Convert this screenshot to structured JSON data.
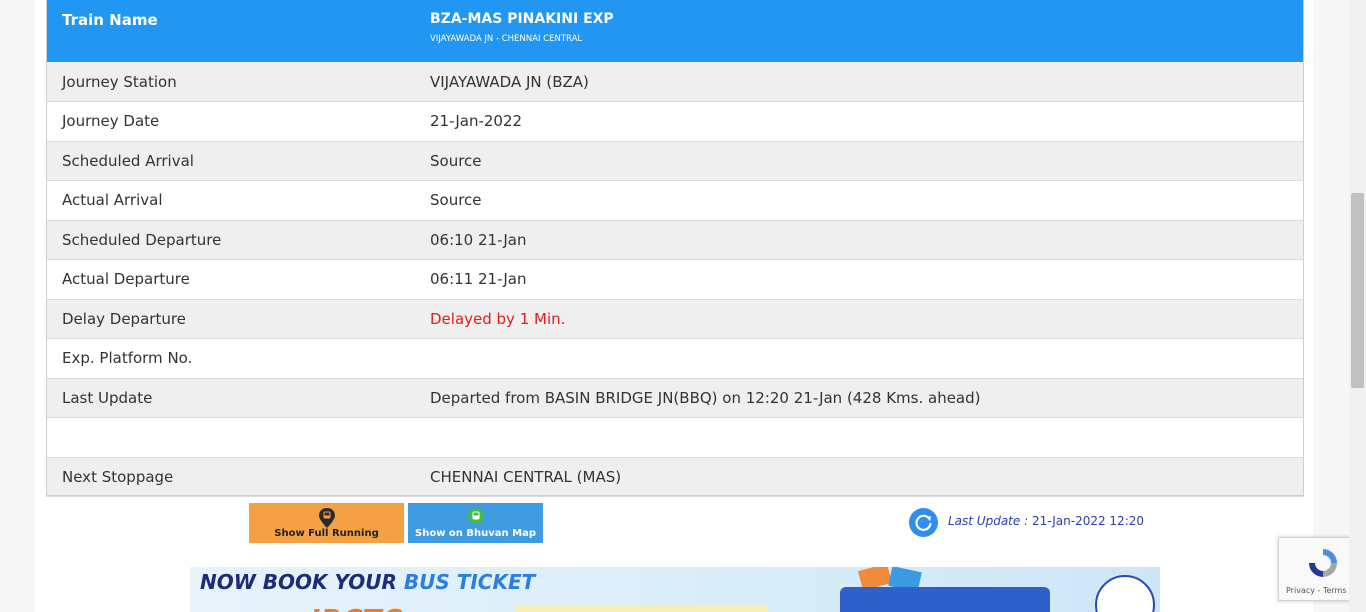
{
  "train": {
    "label": "Train Name",
    "name": "BZA-MAS PINAKINI EXP",
    "route": "VIJAYAWADA JN - CHENNAI CENTRAL"
  },
  "rows": [
    {
      "label": "Journey Station",
      "value": "VIJAYAWADA JN (BZA)"
    },
    {
      "label": "Journey Date",
      "value": "21-Jan-2022"
    },
    {
      "label": "Scheduled Arrival",
      "value": "Source"
    },
    {
      "label": "Actual Arrival",
      "value": "Source"
    },
    {
      "label": "Scheduled Departure",
      "value": "06:10 21-Jan"
    },
    {
      "label": "Actual Departure",
      "value": "06:11 21-Jan"
    },
    {
      "label": "Delay Departure",
      "value": "Delayed by 1 Min."
    },
    {
      "label": "Exp. Platform No.",
      "value": ""
    },
    {
      "label": "Last Update",
      "value": "Departed from BASIN BRIDGE JN(BBQ) on 12:20 21-Jan (428 Kms. ahead)"
    },
    {
      "label": "",
      "value": ""
    },
    {
      "label": "Next Stoppage",
      "value": "CHENNAI CENTRAL (MAS)"
    }
  ],
  "buttons": {
    "full_running": "Show Full Running",
    "bhuvan_map": "Show on Bhuvan Map"
  },
  "last_update": {
    "label": "Last Update :",
    "value": "21-Jan-2022 12:20"
  },
  "banner": {
    "text_prefix": "NOW BOOK YOUR ",
    "text_highlight": "BUS TICKET",
    "brand": "IRCTC"
  },
  "recaptcha": {
    "privacy": "Privacy",
    "separator": " - ",
    "terms": "Terms"
  },
  "colors": {
    "header_blue": "#2196f3",
    "delay_red": "#e01e1e",
    "button_orange": "#f4a044",
    "button_blue": "#3f9be0"
  }
}
